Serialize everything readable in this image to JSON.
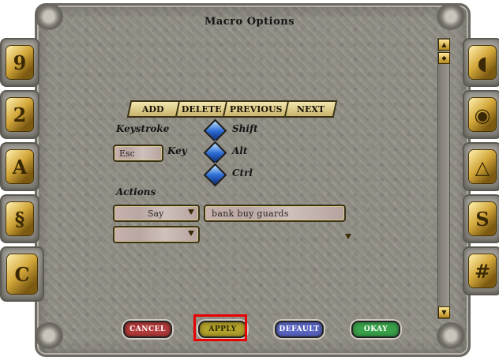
{
  "window": {
    "title": "Macro Options"
  },
  "toolbar": {
    "add": "ADD",
    "delete": "DELETE",
    "previous": "PREVIOUS",
    "next": "NEXT"
  },
  "keystroke": {
    "label": "Keystroke",
    "key_value": "Esc",
    "key_label": "Key",
    "modifiers": {
      "shift": "Shift",
      "alt": "Alt",
      "ctrl": "Ctrl"
    }
  },
  "actions": {
    "label": "Actions",
    "rows": [
      {
        "action": "Say",
        "argument": "bank buy guards"
      },
      {
        "action": "",
        "argument": ""
      }
    ]
  },
  "buttons": {
    "cancel": "CANCEL",
    "apply": "APPLY",
    "default": "DEFAULT",
    "okay": "OKAY"
  },
  "colors": {
    "cancel": "#b23a3a",
    "apply": "#b3a22a",
    "default": "#5a66c2",
    "okay": "#3aa24a",
    "highlight": "#ea0000"
  },
  "side_tabs": {
    "left": [
      "tab-9-icon",
      "tab-2-icon",
      "tab-a-icon",
      "tab-rune-icon",
      "tab-macro-icon"
    ],
    "right": [
      "tab-helm-icon",
      "tab-eye-icon",
      "tab-triangle-icon",
      "tab-s-icon",
      "tab-grid-icon"
    ]
  }
}
